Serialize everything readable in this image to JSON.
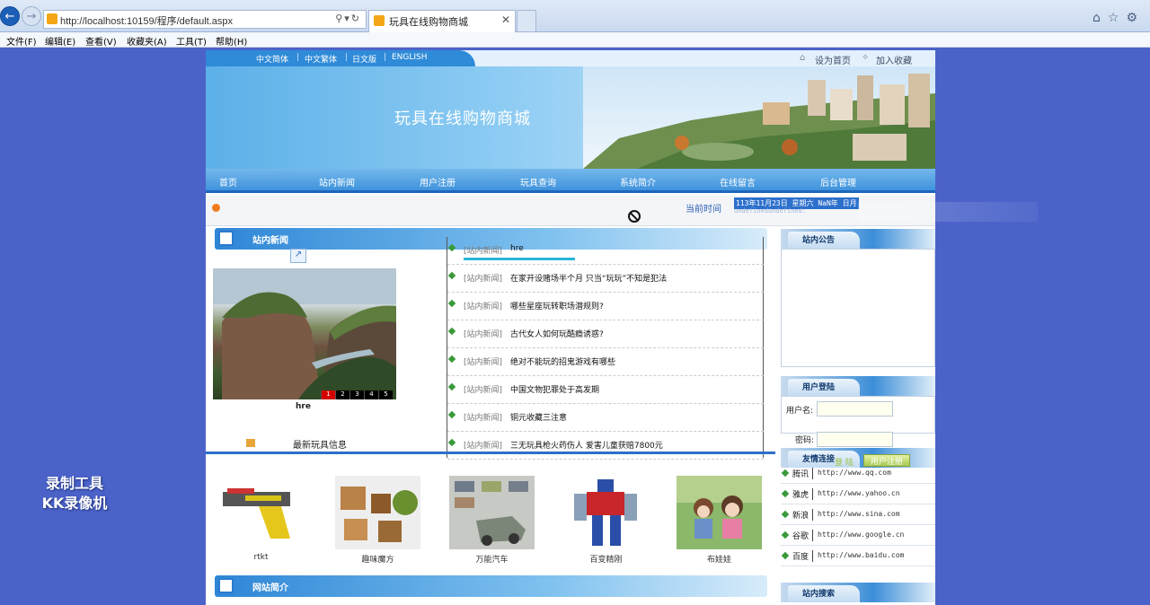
{
  "browser": {
    "url": "http://localhost:10159/程序/default.aspx",
    "tab_title": "玩具在线购物商城",
    "menu": [
      "文件(F)",
      "编辑(E)",
      "查看(V)",
      "收藏夹(A)",
      "工具(T)",
      "帮助(H)"
    ]
  },
  "lang_bar": {
    "items": [
      "中文简体",
      "中文繁体",
      "日文版",
      "ENGLISH"
    ],
    "set_home": "设为首页",
    "add_favorite": "加入收藏"
  },
  "banner": {
    "title": "玩具在线购物商城"
  },
  "nav": [
    "首页",
    "站内新闻",
    "用户注册",
    "玩具查询",
    "系统简介",
    "在线留言",
    "后台管理"
  ],
  "ticker": {
    "label": "当前时间",
    "date": "113年11月23日 星期六 NaN年 日月",
    "date2": "undefinedundefined:"
  },
  "news_section": {
    "title": "站内新闻",
    "photo_caption": "hre",
    "slide_numbers": [
      "1",
      "2",
      "3",
      "4",
      "5"
    ],
    "items": [
      {
        "cat": "[站内新闻]",
        "title": "hre"
      },
      {
        "cat": "[站内新闻]",
        "title": "在家开设赌场半个月 只当“玩玩”不知是犯法"
      },
      {
        "cat": "[站内新闻]",
        "title": "哪些星座玩转职场潜规则?"
      },
      {
        "cat": "[站内新闻]",
        "title": "古代女人如何玩酷瘾诱惑?"
      },
      {
        "cat": "[站内新闻]",
        "title": "绝对不能玩的招鬼游戏有哪些"
      },
      {
        "cat": "[站内新闻]",
        "title": "中国文物犯罪处于高发期"
      },
      {
        "cat": "[站内新闻]",
        "title": "铜元收藏三注意"
      },
      {
        "cat": "[站内新闻]",
        "title": "三无玩具枪火药伤人 爱害儿童获赔7800元"
      }
    ]
  },
  "latest_toys": {
    "title": "最新玩具信息",
    "items": [
      "rtkt",
      "趣味魔方",
      "万能汽车",
      "百变精刚",
      "布娃娃"
    ]
  },
  "site_intro": {
    "title": "网站简介"
  },
  "sidebar": {
    "notice_title": "站内公告",
    "login_title": "用户登陆",
    "username_label": "用户名:",
    "password_label": "密码:",
    "login_button": "登 陆",
    "register_button": "用户注册",
    "links_title": "友情连接",
    "links": [
      {
        "name": "腾讯",
        "url": "http://www.qq.com"
      },
      {
        "name": "雅虎",
        "url": "http://www.yahoo.cn"
      },
      {
        "name": "新浪",
        "url": "http://www.sina.com"
      },
      {
        "name": "谷歌",
        "url": "http://www.google.cn"
      },
      {
        "name": "百度",
        "url": "http://www.baidu.com"
      }
    ],
    "search_title": "站内搜索"
  },
  "watermark": {
    "line1": "录制工具",
    "line2": "KK录像机"
  }
}
